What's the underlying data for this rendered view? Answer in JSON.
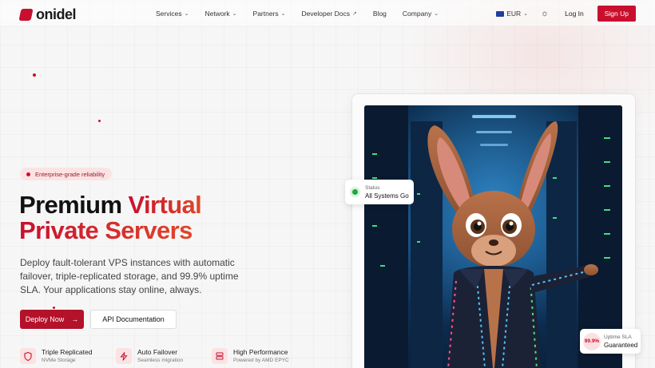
{
  "brand": {
    "name": "onidel"
  },
  "nav": {
    "items": [
      {
        "label": "Services",
        "has_dropdown": true
      },
      {
        "label": "Network",
        "has_dropdown": true
      },
      {
        "label": "Partners",
        "has_dropdown": true
      },
      {
        "label": "Developer Docs",
        "external": true
      },
      {
        "label": "Blog"
      },
      {
        "label": "Company",
        "has_dropdown": true
      }
    ],
    "currency": "EUR",
    "login": "Log In",
    "signup": "Sign Up"
  },
  "hero": {
    "badge": "Enterprise-grade reliability",
    "headline_dark_1": "Premium",
    "headline_red_1": "Virtual",
    "headline_red_2": "Private Servers",
    "description": "Deploy fault-tolerant VPS instances with automatic failover, triple-replicated storage, and 99.9% uptime SLA. Your applications stay online, always.",
    "primary_cta": "Deploy Now",
    "secondary_cta": "API Documentation",
    "features": [
      {
        "icon": "shield-icon",
        "title": "Triple Replicated",
        "subtitle": "NVMe Storage"
      },
      {
        "icon": "lightning-icon",
        "title": "Auto Failover",
        "subtitle": "Seamless migration"
      },
      {
        "icon": "server-icon",
        "title": "High Performance",
        "subtitle": "Powered by AMD EPYC"
      }
    ]
  },
  "status_card": {
    "label": "Status",
    "value": "All Systems Go"
  },
  "sla_card": {
    "badge": "99.9%",
    "label": "Uptime SLA",
    "value": "Guaranteed"
  },
  "colors": {
    "accent": "#c8102e",
    "status_green": "#1faa3f"
  }
}
